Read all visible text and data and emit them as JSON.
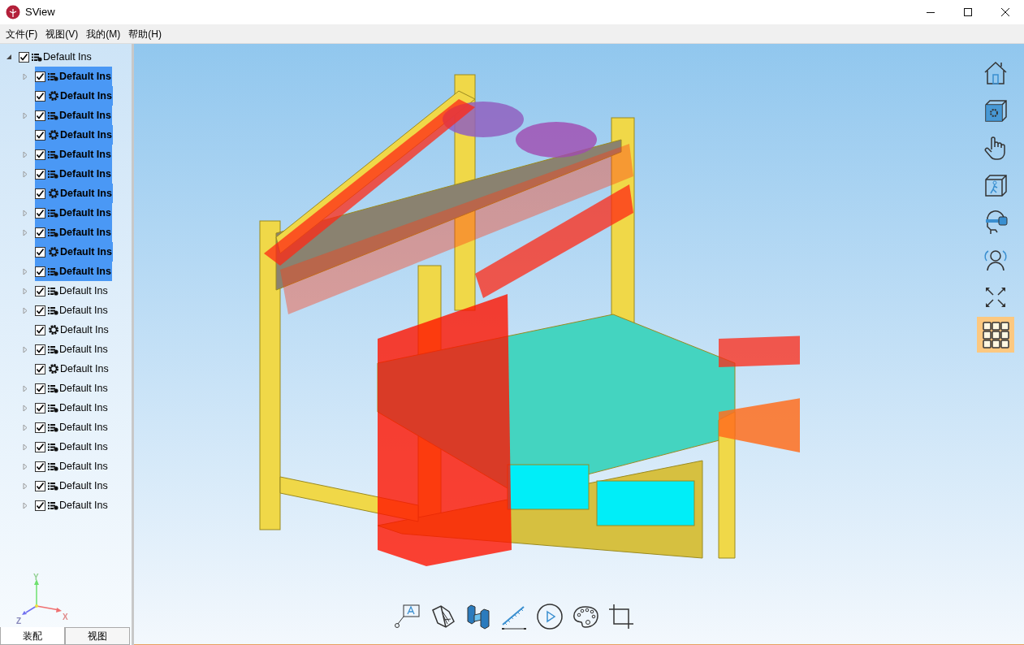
{
  "window": {
    "title": "SView"
  },
  "menu": [
    "文件(F)",
    "视图(V)",
    "我的(M)",
    "帮助(H)"
  ],
  "tree": {
    "label": "Default Ins",
    "kind": "assembly",
    "checked": true,
    "expanded": true,
    "selected": false,
    "children": [
      {
        "label": "Default Ins",
        "kind": "assembly",
        "checked": true,
        "selected": true
      },
      {
        "label": "Default Ins",
        "kind": "part",
        "checked": true,
        "selected": true
      },
      {
        "label": "Default Ins",
        "kind": "assembly",
        "checked": true,
        "selected": true
      },
      {
        "label": "Default Ins",
        "kind": "part",
        "checked": true,
        "selected": true
      },
      {
        "label": "Default Ins",
        "kind": "assembly",
        "checked": true,
        "selected": true
      },
      {
        "label": "Default Ins",
        "kind": "assembly",
        "checked": true,
        "selected": true
      },
      {
        "label": "Default Ins",
        "kind": "part",
        "checked": true,
        "selected": true
      },
      {
        "label": "Default Ins",
        "kind": "assembly",
        "checked": true,
        "selected": true
      },
      {
        "label": "Default Ins",
        "kind": "assembly",
        "checked": true,
        "selected": true
      },
      {
        "label": "Default Ins",
        "kind": "part",
        "checked": true,
        "selected": true
      },
      {
        "label": "Default Ins",
        "kind": "assembly",
        "checked": true,
        "selected": true
      },
      {
        "label": "Default Ins",
        "kind": "assembly",
        "checked": true,
        "selected": false
      },
      {
        "label": "Default Ins",
        "kind": "assembly",
        "checked": true,
        "selected": false
      },
      {
        "label": "Default Ins",
        "kind": "part",
        "checked": true,
        "selected": false
      },
      {
        "label": "Default Ins",
        "kind": "assembly",
        "checked": true,
        "selected": false
      },
      {
        "label": "Default Ins",
        "kind": "part",
        "checked": true,
        "selected": false
      },
      {
        "label": "Default Ins",
        "kind": "assembly",
        "checked": true,
        "selected": false
      },
      {
        "label": "Default Ins",
        "kind": "assembly",
        "checked": true,
        "selected": false
      },
      {
        "label": "Default Ins",
        "kind": "assembly",
        "checked": true,
        "selected": false
      },
      {
        "label": "Default Ins",
        "kind": "assembly",
        "checked": true,
        "selected": false
      },
      {
        "label": "Default Ins",
        "kind": "assembly",
        "checked": true,
        "selected": false
      },
      {
        "label": "Default Ins",
        "kind": "assembly",
        "checked": true,
        "selected": false
      },
      {
        "label": "Default Ins",
        "kind": "assembly",
        "checked": true,
        "selected": false
      }
    ]
  },
  "axes": {
    "x": "X",
    "y": "Y",
    "z": "Z"
  },
  "panel_tabs": [
    {
      "label": "装配",
      "selected": true
    },
    {
      "label": "视图",
      "selected": false
    }
  ],
  "right_toolbar": [
    {
      "kind": "home",
      "selected": false
    },
    {
      "kind": "view-settings",
      "selected": false
    },
    {
      "kind": "hand",
      "selected": false
    },
    {
      "kind": "walk",
      "selected": false
    },
    {
      "kind": "vr",
      "selected": false
    },
    {
      "kind": "users",
      "selected": false
    },
    {
      "kind": "fullscreen",
      "selected": false
    },
    {
      "kind": "grid",
      "selected": true
    }
  ],
  "bottom_toolbar": [
    {
      "kind": "annotate"
    },
    {
      "kind": "section"
    },
    {
      "kind": "explode"
    },
    {
      "kind": "measure"
    },
    {
      "kind": "play"
    },
    {
      "kind": "palette"
    },
    {
      "kind": "crop"
    }
  ]
}
